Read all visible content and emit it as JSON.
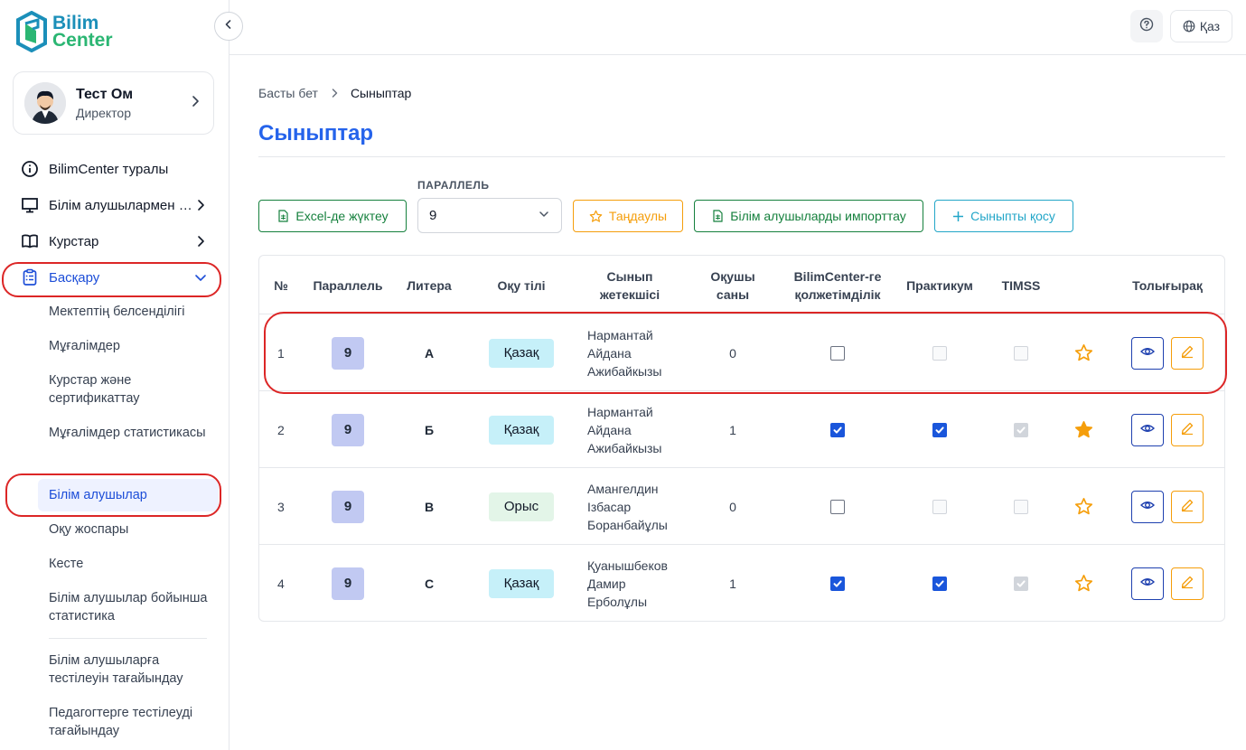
{
  "brand": {
    "line1": "Bilim",
    "line2": "Center"
  },
  "user": {
    "name": "Тест Ом",
    "role": "Директор"
  },
  "nav": {
    "items": [
      {
        "label": "BilimCenter туралы"
      },
      {
        "label": "Білім алушылармен жұмыс"
      },
      {
        "label": "Курстар"
      },
      {
        "label": "Басқару"
      }
    ],
    "sub_items": [
      {
        "label": "Мектептің белсенділігі"
      },
      {
        "label": "Мұғалімдер"
      },
      {
        "label": "Курстар және сертификаттау"
      },
      {
        "label": "Мұғалімдер статистикасы"
      },
      {
        "label": "Білім алушылар"
      },
      {
        "label": "Оқу жоспары"
      },
      {
        "label": "Кесте"
      },
      {
        "label": "Білім алушылар бойынша статистика"
      },
      {
        "label": "Білім алушыларға тестілеуін тағайындау"
      },
      {
        "label": "Педагогтерге тестілеуді тағайындау"
      }
    ]
  },
  "topbar": {
    "language": "Қаз"
  },
  "breadcrumb": {
    "home": "Басты бет",
    "current": "Сыныптар"
  },
  "page": {
    "title": "Сыныптар"
  },
  "toolbar": {
    "excel": "Excel-де жүктеу",
    "parallel_label": "ПАРАЛЛЕЛЬ",
    "parallel_value": "9",
    "favorites": "Таңдаулы",
    "import": "Білім алушыларды импорттау",
    "add_class": "Сыныпты қосу"
  },
  "table": {
    "headers": {
      "num": "№",
      "parallel": "Параллель",
      "litera": "Литера",
      "language": "Оқу тілі",
      "teacher_l1": "Сынып",
      "teacher_l2": "жетекшісі",
      "count_l1": "Оқушы",
      "count_l2": "саны",
      "access_l1": "BilimCenter-ге",
      "access_l2": "қолжетімділік",
      "practicum": "Практикум",
      "timss": "TIMSS",
      "more": "Толығырақ"
    },
    "rows": [
      {
        "num": "1",
        "parallel": "9",
        "litera": "А",
        "language": "Қазақ",
        "lang_type": "kz",
        "teacher": [
          "Нармантай",
          "Айдана",
          "Ажибайкызы"
        ],
        "count": "0",
        "access": false,
        "practicum": false,
        "timss": false,
        "favorite": false
      },
      {
        "num": "2",
        "parallel": "9",
        "litera": "Б",
        "language": "Қазақ",
        "lang_type": "kz",
        "teacher": [
          "Нармантай",
          "Айдана",
          "Ажибайкызы"
        ],
        "count": "1",
        "access": true,
        "practicum": true,
        "timss": true,
        "favorite": true
      },
      {
        "num": "3",
        "parallel": "9",
        "litera": "В",
        "language": "Орыс",
        "lang_type": "ru",
        "teacher": [
          "Амангелдин",
          "Ізбасар",
          "Боранбайұлы"
        ],
        "count": "0",
        "access": false,
        "practicum": false,
        "timss": false,
        "favorite": false
      },
      {
        "num": "4",
        "parallel": "9",
        "litera": "С",
        "language": "Қазақ",
        "lang_type": "kz",
        "teacher": [
          "Қуанышбеков",
          "Дамир",
          "Ерболұлы"
        ],
        "count": "1",
        "access": true,
        "practicum": true,
        "timss": true,
        "favorite": false
      }
    ]
  },
  "colors": {
    "accent": "#2563eb",
    "green": "#15803d",
    "amber": "#f59e0b",
    "cyan": "#22a6c8",
    "highlight": "#dc2626"
  },
  "icons": [
    "logo-mark-icon",
    "chevron-left-icon",
    "chevron-right-icon",
    "chevron-down-icon",
    "info-icon",
    "monitor-icon",
    "book-icon",
    "clipboard-icon",
    "help-icon",
    "globe-icon",
    "spreadsheet-icon",
    "star-icon",
    "plus-icon",
    "eye-icon",
    "pencil-icon",
    "check-icon"
  ]
}
